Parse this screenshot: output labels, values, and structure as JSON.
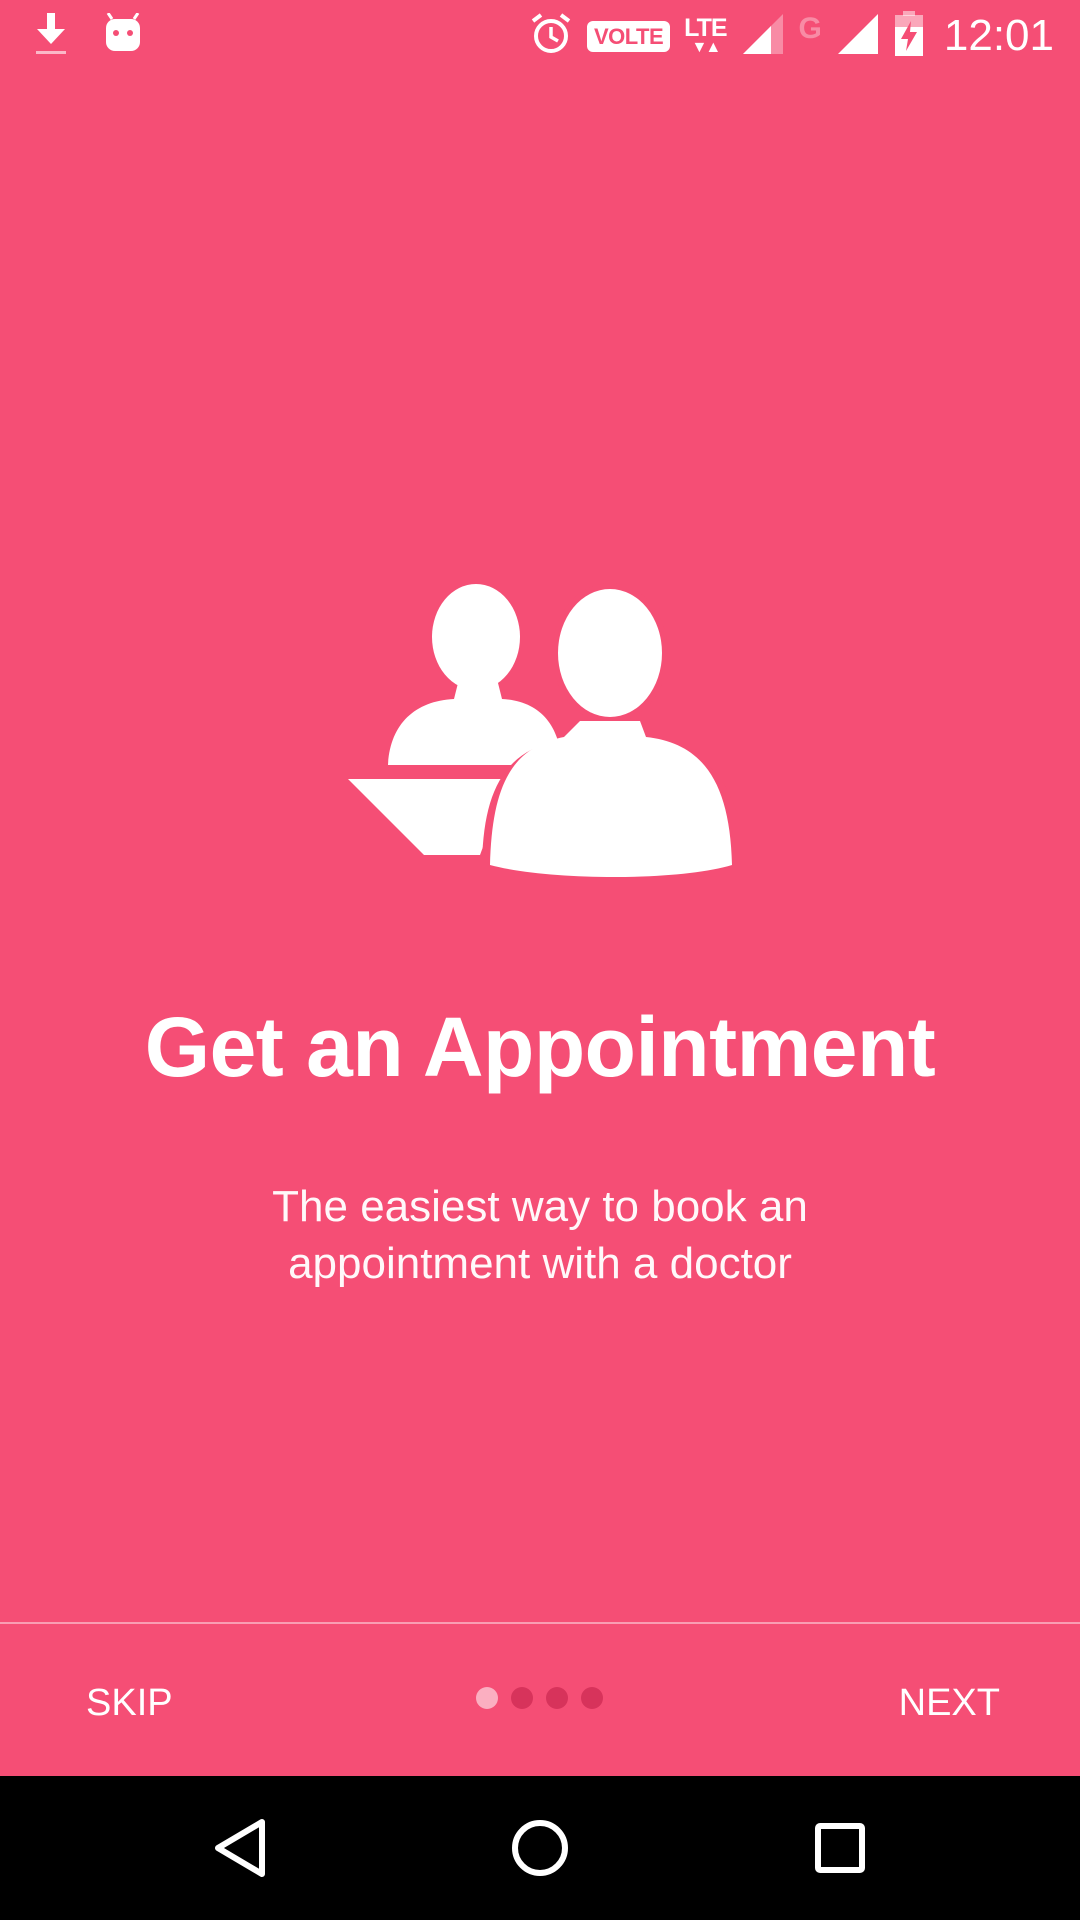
{
  "status_bar": {
    "left_icons": [
      "download-icon",
      "android-icon"
    ],
    "right_icons": [
      "alarm-icon",
      "volte-badge",
      "lte-icon",
      "signal-icon",
      "g-network-icon",
      "signal-icon",
      "battery-charging-icon"
    ],
    "volte_label": "VOLTE",
    "lte_label": "LTE",
    "g_label": "G",
    "time": "12:01"
  },
  "onboarding": {
    "illustration_icon": "doctor-patient-icon",
    "title": "Get an Appointment",
    "subtitle_line1": "The easiest way to book an",
    "subtitle_line2": "appointment with a doctor",
    "page_indicator": {
      "current": 1,
      "total": 4
    }
  },
  "bottom_bar": {
    "skip_label": "SKIP",
    "next_label": "NEXT"
  },
  "system_nav": {
    "buttons": [
      "back-icon",
      "home-icon",
      "recents-icon"
    ]
  },
  "colors": {
    "background": "#f54e75",
    "dot_inactive": "#d7335b",
    "nav_bar": "#000000",
    "text": "#ffffff"
  }
}
